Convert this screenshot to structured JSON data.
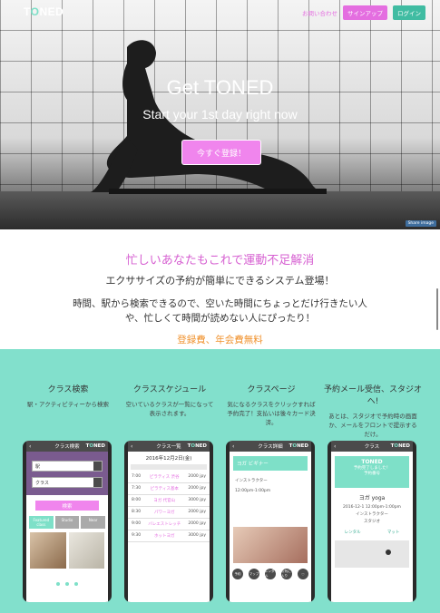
{
  "header": {
    "logo_t": "T",
    "logo_o": "O",
    "logo_rest": "NED",
    "contact": "お問い合わせ",
    "signup": "サインアップ",
    "login": "ログイン"
  },
  "hero": {
    "title": "Get TONED",
    "subtitle": "Start your 1st day right now",
    "cta": "今すぐ登録！",
    "share": "Share image"
  },
  "intro": {
    "headline": "忙しいあなたもこれで運動不足解消",
    "subhead": "エクササイズの予約が簡単にできるシステム登場！",
    "body_line1": "時間、駅から検索できるので、空いた時間にちょっとだけ行きたい人",
    "body_line2": "や、忙しくて時間が読めない人にぴったり！",
    "fee": "登録費、年会費無料"
  },
  "features": [
    {
      "title": "クラス検索",
      "desc": "駅・アクティビティーから検索"
    },
    {
      "title": "クラススケジュール",
      "desc": "空いているクラスが一覧になって表示されます。"
    },
    {
      "title": "クラスページ",
      "desc": "気になるクラスをクリックすれば予約完了！支払いは後々カード決済。"
    },
    {
      "title": "予約メール受信、スタジオへ!",
      "desc": "あとは、スタジオで予約時の画面か、メールをフロントで提示するだけ。"
    }
  ],
  "phones": {
    "search": {
      "bar": "クラス検索",
      "f1": "駅",
      "f2": "クラス",
      "btn": "検索",
      "tab1": "Featured class",
      "tab2": "Studio",
      "tab3": "Near"
    },
    "schedule": {
      "bar": "クラス一覧",
      "date": "2016年12月2日(金)",
      "rows": [
        [
          "7:00",
          "ピラティス 渋谷",
          "2000 jpy"
        ],
        [
          "7:30",
          "ピラティス基本",
          "2000 jpy"
        ],
        [
          "8:00",
          "ヨガ 代官山",
          "3000 jpy"
        ],
        [
          "8:30",
          "パワーヨガ",
          "2000 jpy"
        ],
        [
          "9:00",
          "バレエストレッチ",
          "2000 jpy"
        ],
        [
          "9:30",
          "ホットヨガ",
          "3000 jpy"
        ]
      ]
    },
    "classpage": {
      "bar": "クラス詳細",
      "title": "ヨガ ビギナー",
      "info1": "インストラクター",
      "info2": "12:00pm-1:00pm",
      "buttons": [
        "予約",
        "マップ",
        "レンタル",
        "お気に入り",
        "♡"
      ]
    },
    "mail": {
      "bar": "クラス",
      "sub": "予約完了しました！",
      "b2": "予約番号",
      "name": "ヨガ yoga",
      "time": "2016-12-1  12:00pm-1:00pm",
      "instructor": "インストラクター",
      "studio": "スタジオ",
      "rental": "レンタル",
      "map": "マット"
    }
  },
  "colors": {
    "pink": "#e46ee0",
    "teal": "#82e0cc",
    "orange": "#f0922e"
  }
}
